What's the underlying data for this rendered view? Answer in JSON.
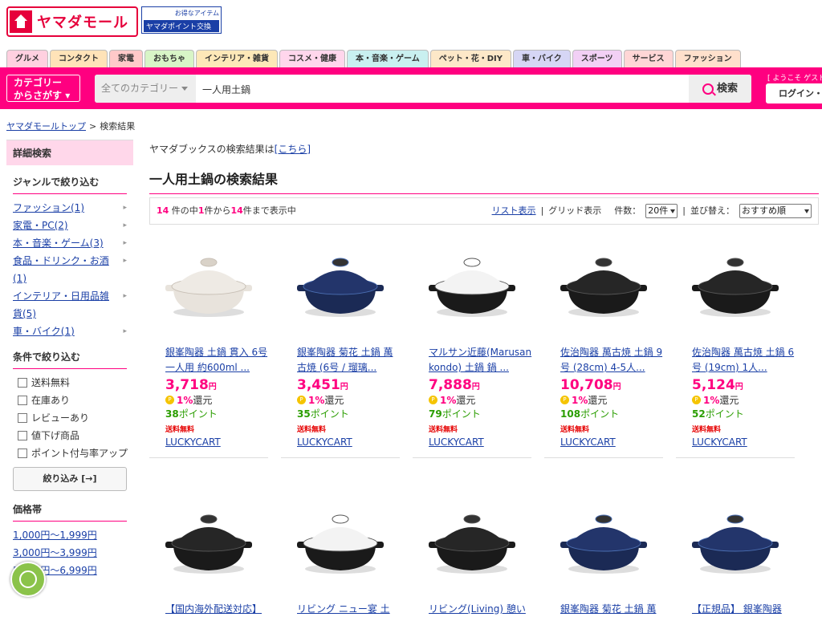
{
  "header": {
    "logo_text": "ヤマダモール",
    "point_banner_line1": "お得なアイテム",
    "point_banner_line2": "ヤマダポイント交換"
  },
  "categories": [
    "グルメ",
    "コンタクト",
    "家電",
    "おもちゃ",
    "インテリア・雑貨",
    "コスメ・健康",
    "本・音楽・ゲーム",
    "ペット・花・DIY",
    "車・バイク",
    "スポーツ",
    "サービス",
    "ファッション"
  ],
  "category_colors": [
    "#ffd0e0",
    "#ffe3b8",
    "#ffc9c9",
    "#d8f5c7",
    "#fde8b8",
    "#ffd6ec",
    "#c9f0f0",
    "#fde8c8",
    "#d6d6f5",
    "#f2d0f5",
    "#ffd6d6",
    "#ffe0cc"
  ],
  "search": {
    "category_button": "カテゴリー\nからさがす",
    "category_select": "全てのカテゴリー",
    "query": "一人用土鍋",
    "button": "検索",
    "welcome": "[ ようこそ ゲスト",
    "login": "ログイン・"
  },
  "breadcrumb": {
    "home": "ヤマダモールトップ",
    "sep": ">",
    "current": "検索結果"
  },
  "sidebar": {
    "title": "詳細検索",
    "genre_title": "ジャンルで絞り込む",
    "genres": [
      "ファッション(1)",
      "家電・PC(2)",
      "本・音楽・ゲーム(3)",
      "食品・ドリンク・お酒(1)",
      "インテリア・日用品雑貨(5)",
      "車・バイク(1)"
    ],
    "cond_title": "条件で絞り込む",
    "conditions": [
      "送料無料",
      "在庫あり",
      "レビューあり",
      "値下げ商品",
      "ポイント付与率アップ"
    ],
    "narrow_button": "絞り込み [→]",
    "price_title": "価格帯",
    "prices": [
      "1,000円〜1,999円",
      "3,000円〜3,999円",
      "5,000円〜6,999円"
    ]
  },
  "main": {
    "books_note_prefix": "ヤマダブックスの検索結果は",
    "books_note_link": "[こちら]",
    "heading": "一人用土鍋の検索結果",
    "count_total": "14",
    "count_text1": " 件の中",
    "count_from": "1",
    "count_text2": "件から",
    "count_to": "14",
    "count_text3": "件まで表示中",
    "list_view": "リスト表示",
    "grid_view": "グリッド表示",
    "per_page_label": "件数：",
    "per_page": "20件",
    "sort_label": "並び替え：",
    "sort": "おすすめ順"
  },
  "products": [
    {
      "name": "銀峯陶器 土鍋 貫入 6号 一人用 約600ml ...",
      "price": "3,718",
      "yen": "円",
      "rate": "1%",
      "rate_suffix": "還元",
      "points": "38",
      "points_suffix": "ポイント",
      "shipping": "送料無料",
      "shop": "LUCKYCART",
      "style": "white"
    },
    {
      "name": "銀峯陶器 菊花 土鍋 萬古焼 (6号 / 瑠璃...",
      "price": "3,451",
      "yen": "円",
      "rate": "1%",
      "rate_suffix": "還元",
      "points": "35",
      "points_suffix": "ポイント",
      "shipping": "送料無料",
      "shop": "LUCKYCART",
      "style": "blue"
    },
    {
      "name": "マルサン近藤(Marusankondo) 土鍋 鍋 ...",
      "price": "7,888",
      "yen": "円",
      "rate": "1%",
      "rate_suffix": "還元",
      "points": "79",
      "points_suffix": "ポイント",
      "shipping": "送料無料",
      "shop": "LUCKYCART",
      "style": "whiteblack"
    },
    {
      "name": "佐治陶器 萬古焼 土鍋 9号 (28cm) 4-5人...",
      "price": "10,708",
      "yen": "円",
      "rate": "1%",
      "rate_suffix": "還元",
      "points": "108",
      "points_suffix": "ポイント",
      "shipping": "送料無料",
      "shop": "LUCKYCART",
      "style": "black"
    },
    {
      "name": "佐治陶器 萬古焼 土鍋 6号 (19cm) 1人...",
      "price": "5,124",
      "yen": "円",
      "rate": "1%",
      "rate_suffix": "還元",
      "points": "52",
      "points_suffix": "ポイント",
      "shipping": "送料無料",
      "shop": "LUCKYCART",
      "style": "black"
    },
    {
      "name": "【国内海外配送対応】",
      "style": "black"
    },
    {
      "name": "リビング ニュー宴 土",
      "style": "whiteblack"
    },
    {
      "name": "リビング(Living) 憩い",
      "style": "black"
    },
    {
      "name": "銀峯陶器 菊花 土鍋 萬",
      "style": "blue"
    },
    {
      "name": "【正規品】 銀峯陶器",
      "style": "blue"
    }
  ]
}
